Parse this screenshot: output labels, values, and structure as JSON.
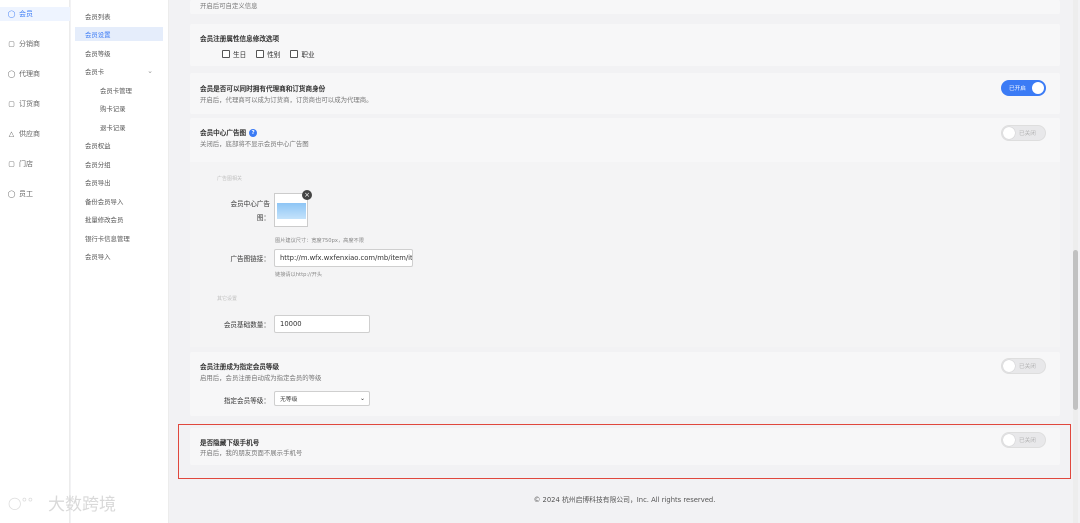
{
  "nav1": [
    {
      "label": "会员",
      "icon": "user-icon",
      "active": true
    },
    {
      "label": "分销商",
      "icon": "box-icon"
    },
    {
      "label": "代理商",
      "icon": "agent-icon"
    },
    {
      "label": "订货商",
      "icon": "order-icon"
    },
    {
      "label": "供应商",
      "icon": "supplier-icon"
    },
    {
      "label": "门店",
      "icon": "store-icon"
    },
    {
      "label": "员工",
      "icon": "staff-icon"
    }
  ],
  "nav2": [
    {
      "label": "会员列表"
    },
    {
      "label": "会员设置",
      "active": true
    },
    {
      "label": "会员等级"
    },
    {
      "label": "会员卡"
    },
    {
      "label": "会员卡管理",
      "sub": true
    },
    {
      "label": "购卡记录",
      "sub": true
    },
    {
      "label": "退卡记录",
      "sub": true
    },
    {
      "label": "会员权益"
    },
    {
      "label": "会员分组"
    },
    {
      "label": "会员导出"
    },
    {
      "label": "备份会员导入"
    },
    {
      "label": "批量修改会员"
    },
    {
      "label": "银行卡信息管理"
    },
    {
      "label": "会员导入"
    }
  ],
  "main": {
    "top_note": "开启后可自定义信息",
    "attr_panel": {
      "title": "会员注册属性信息修改选项",
      "options": [
        "生日",
        "性别",
        "职业"
      ]
    },
    "identity_panel": {
      "title": "会员是否可以同时拥有代理商和订货商身份",
      "desc": "开启后，代理商可以成为订货商，订货商也可以成为代理商。",
      "toggle": "已开启"
    },
    "ad_panel": {
      "title": "会员中心广告图",
      "desc": "关闭后，底部将不显示会员中心广告图",
      "toggle": "已关闭",
      "section1": "广告图相关",
      "image_label": "会员中心广告图：",
      "image_hint": "图片建议尺寸：宽度750px，高度不限",
      "link_label": "广告图链接：",
      "link_value": "http://m.wfx.wxfenxiao.com/mb/item/ite",
      "link_hint": "链接请以http://开头",
      "section2": "其它设置",
      "base_label": "会员基础数量：",
      "base_value": "10000"
    },
    "level_panel": {
      "title": "会员注册成为指定会员等级",
      "desc": "启用后，会员注册自动成为指定会员的等级",
      "toggle": "已关闭",
      "select_label": "指定会员等级：",
      "select_value": "无等级"
    },
    "hide_panel": {
      "title": "是否隐藏下级手机号",
      "desc": "开启后，我的朋友页面不展示手机号",
      "toggle": "已关闭"
    },
    "footer": "© 2024 杭州启博科技有限公司，Inc. All rights reserved."
  },
  "watermark": "大数跨境"
}
